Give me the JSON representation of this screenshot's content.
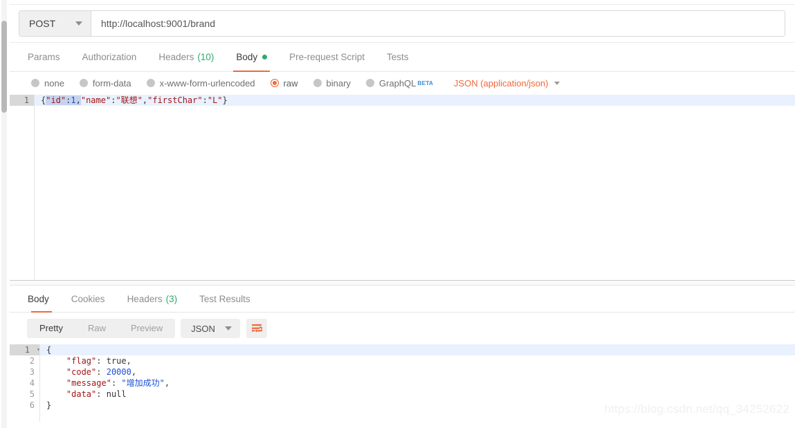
{
  "request": {
    "method": "POST",
    "url": "http://localhost:9001/brand",
    "tabs": [
      {
        "label": "Params",
        "count": "",
        "active": false,
        "dot": false
      },
      {
        "label": "Authorization",
        "count": "",
        "active": false,
        "dot": false
      },
      {
        "label": "Headers",
        "count": "(10)",
        "active": false,
        "dot": false
      },
      {
        "label": "Body",
        "count": "",
        "active": true,
        "dot": true
      },
      {
        "label": "Pre-request Script",
        "count": "",
        "active": false,
        "dot": false
      },
      {
        "label": "Tests",
        "count": "",
        "active": false,
        "dot": false
      }
    ],
    "body_types": [
      {
        "label": "none",
        "selected": false,
        "beta": ""
      },
      {
        "label": "form-data",
        "selected": false,
        "beta": ""
      },
      {
        "label": "x-www-form-urlencoded",
        "selected": false,
        "beta": ""
      },
      {
        "label": "raw",
        "selected": true,
        "beta": ""
      },
      {
        "label": "binary",
        "selected": false,
        "beta": ""
      },
      {
        "label": "GraphQL",
        "selected": false,
        "beta": "BETA"
      }
    ],
    "content_type": "JSON (application/json)",
    "editor": {
      "lines": [
        {
          "num": "1",
          "highlighted": true,
          "current": true,
          "tokens": [
            {
              "text": "{",
              "cls": "t-punc"
            },
            {
              "text": "\"id\"",
              "cls": "t-key t-sel"
            },
            {
              "text": ":",
              "cls": "t-punc t-sel"
            },
            {
              "text": "1",
              "cls": "t-num t-sel"
            },
            {
              "text": ",",
              "cls": "t-punc t-sel"
            },
            {
              "text": "\"name\"",
              "cls": "t-key"
            },
            {
              "text": ":",
              "cls": "t-punc"
            },
            {
              "text": "\"联想\"",
              "cls": "t-str"
            },
            {
              "text": ",",
              "cls": "t-punc"
            },
            {
              "text": "\"firstChar\"",
              "cls": "t-key"
            },
            {
              "text": ":",
              "cls": "t-punc"
            },
            {
              "text": "\"L\"",
              "cls": "t-str"
            },
            {
              "text": "}",
              "cls": "t-punc"
            }
          ]
        }
      ],
      "raw_text": "{\"id\":1,\"name\":\"联想\",\"firstChar\":\"L\"}"
    }
  },
  "response": {
    "tabs": [
      {
        "label": "Body",
        "count": "",
        "active": true
      },
      {
        "label": "Cookies",
        "count": "",
        "active": false
      },
      {
        "label": "Headers",
        "count": "(3)",
        "active": false
      },
      {
        "label": "Test Results",
        "count": "",
        "active": false
      }
    ],
    "view_modes": [
      {
        "label": "Pretty",
        "active": true
      },
      {
        "label": "Raw",
        "active": false
      },
      {
        "label": "Preview",
        "active": false
      }
    ],
    "format": "JSON",
    "wrap_icon": "word-wrap-icon",
    "editor": {
      "lines": [
        {
          "num": "1",
          "highlighted": true,
          "current": true,
          "fold": "▾",
          "tokens": [
            {
              "text": "{",
              "cls": "t-punc"
            }
          ]
        },
        {
          "num": "2",
          "highlighted": false,
          "current": false,
          "fold": "",
          "tokens": [
            {
              "text": "    ",
              "cls": "t-punc"
            },
            {
              "text": "\"flag\"",
              "cls": "t-key"
            },
            {
              "text": ": ",
              "cls": "t-punc"
            },
            {
              "text": "true",
              "cls": "t-lit"
            },
            {
              "text": ",",
              "cls": "t-punc"
            }
          ]
        },
        {
          "num": "3",
          "highlighted": false,
          "current": false,
          "fold": "",
          "tokens": [
            {
              "text": "    ",
              "cls": "t-punc"
            },
            {
              "text": "\"code\"",
              "cls": "t-key"
            },
            {
              "text": ": ",
              "cls": "t-punc"
            },
            {
              "text": "20000",
              "cls": "t-num"
            },
            {
              "text": ",",
              "cls": "t-punc"
            }
          ]
        },
        {
          "num": "4",
          "highlighted": false,
          "current": false,
          "fold": "",
          "tokens": [
            {
              "text": "    ",
              "cls": "t-punc"
            },
            {
              "text": "\"message\"",
              "cls": "t-key"
            },
            {
              "text": ": ",
              "cls": "t-punc"
            },
            {
              "text": "\"增加成功\"",
              "cls": "t-cn"
            },
            {
              "text": ",",
              "cls": "t-punc"
            }
          ]
        },
        {
          "num": "5",
          "highlighted": false,
          "current": false,
          "fold": "",
          "tokens": [
            {
              "text": "    ",
              "cls": "t-punc"
            },
            {
              "text": "\"data\"",
              "cls": "t-key"
            },
            {
              "text": ": ",
              "cls": "t-punc"
            },
            {
              "text": "null",
              "cls": "t-lit"
            }
          ]
        },
        {
          "num": "6",
          "highlighted": false,
          "current": false,
          "fold": "",
          "tokens": [
            {
              "text": "}",
              "cls": "t-punc"
            }
          ]
        }
      ],
      "raw_text": "{\n    \"flag\": true,\n    \"code\": 20000,\n    \"message\": \"增加成功\",\n    \"data\": null\n}"
    }
  },
  "watermark": "https://blog.csdn.net/qq_34252622",
  "colors": {
    "accent": "#f1683a",
    "green": "#2bab6b",
    "blue": "#1a4fd6",
    "string": "#a31515",
    "current_line": "#e8f1fd"
  }
}
